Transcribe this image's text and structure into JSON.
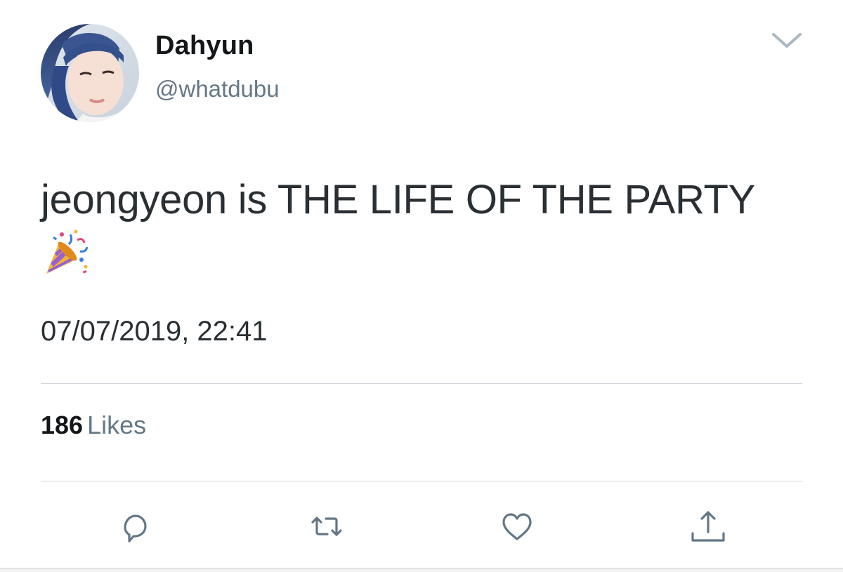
{
  "author": {
    "display_name": "Dahyun",
    "handle": "@whatdubu"
  },
  "tweet": {
    "text": "jeongyeon is THE LIFE OF THE PARTY",
    "emoji": "party-popper",
    "timestamp": "07/07/2019, 22:41"
  },
  "stats": {
    "likes_count": "186",
    "likes_label": "Likes"
  },
  "actions": [
    "reply",
    "retweet",
    "like",
    "share"
  ],
  "colors": {
    "text_primary": "#14171a",
    "text_body": "#292f33",
    "text_secondary": "#657786",
    "divider": "#d0d6db",
    "icon": "#657786"
  }
}
